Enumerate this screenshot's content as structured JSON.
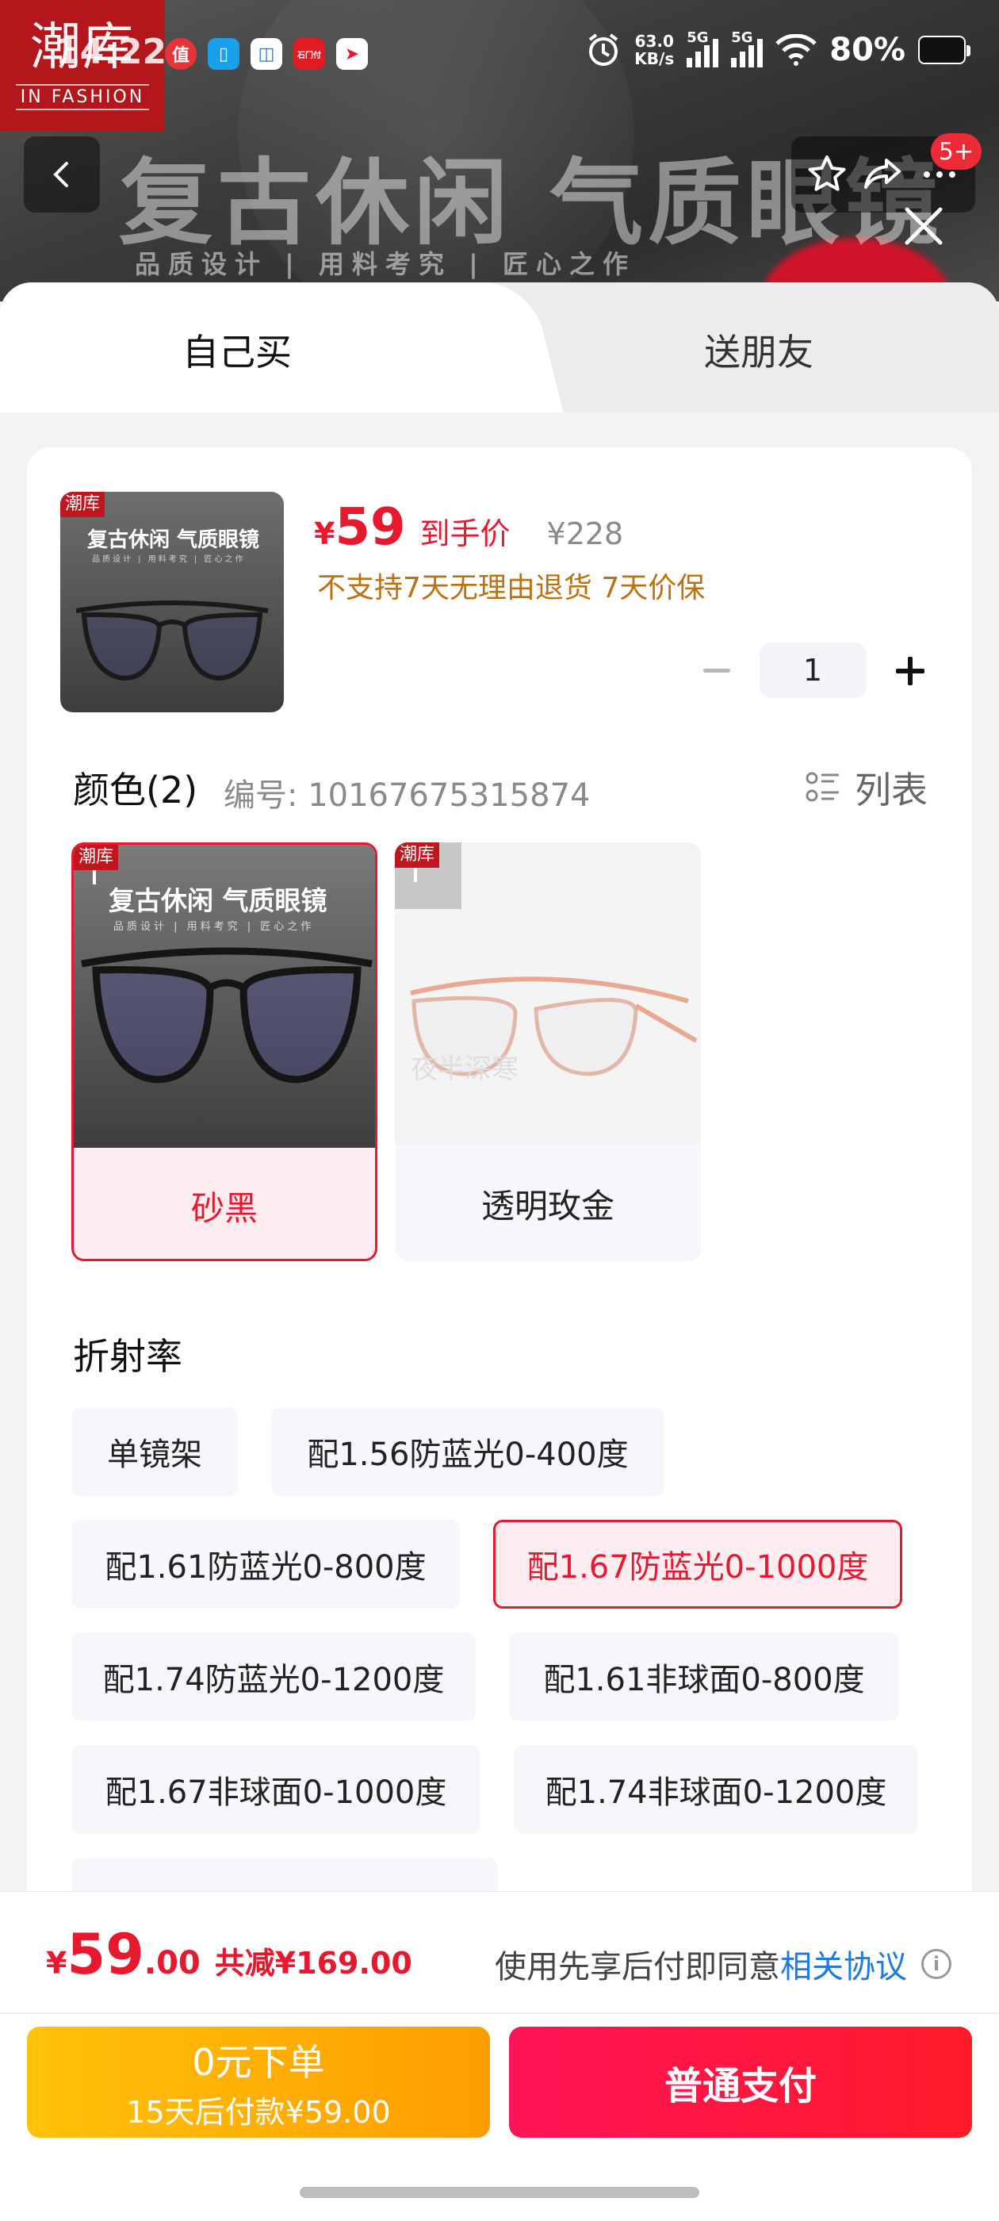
{
  "status_bar": {
    "time": "14:22",
    "net_speed_value": "63.0",
    "net_speed_unit": "KB/s",
    "signal_label_1": "5G",
    "signal_label_2": "5G",
    "battery": "80%",
    "app_badge_text": "石门付"
  },
  "banner": {
    "brand_cn": "潮库",
    "brand_en": "IN FASHION",
    "title": "复古休闲 气质眼镜",
    "subtitle": "品质设计 | 用料考究 | 匠心之作",
    "cart_badge": "5+"
  },
  "tabs": [
    {
      "label": "自己买",
      "active": true
    },
    {
      "label": "送朋友",
      "active": false
    }
  ],
  "product": {
    "thumb_tag": "潮库",
    "thumb_title": "复古休闲 气质眼镜",
    "thumb_subtitle": "品质设计 | 用料考究 | 匠心之作",
    "currency": "¥",
    "price": "59",
    "price_label": "到手价",
    "original_price": "¥228",
    "policy": "不支持7天无理由退货  7天价保",
    "quantity": "1"
  },
  "color_section": {
    "title": "颜色(2)",
    "sku_number": "编号: 10167675315874",
    "list_toggle_label": "列表",
    "options": [
      {
        "label": "砂黑",
        "selected": true,
        "tag": "潮库",
        "img_title": "复古休闲 气质眼镜",
        "img_subtitle": "品质设计 | 用料考究 | 匠心之作"
      },
      {
        "label": "透明玫金",
        "selected": false,
        "tag": "潮库",
        "watermark": "夜半深寒"
      }
    ]
  },
  "refraction_section": {
    "title": "折射率",
    "options": [
      {
        "label": "单镜架",
        "selected": false
      },
      {
        "label": "配1.56防蓝光0-400度",
        "selected": false
      },
      {
        "label": "配1.61防蓝光0-800度",
        "selected": false
      },
      {
        "label": "配1.67防蓝光0-1000度",
        "selected": true
      },
      {
        "label": "配1.74防蓝光0-1200度",
        "selected": false
      },
      {
        "label": "配1.61非球面0-800度",
        "selected": false
      },
      {
        "label": "配1.67非球面0-1000度",
        "selected": false
      },
      {
        "label": "配1.74非球面0-1200度",
        "selected": false
      }
    ]
  },
  "bottom_bar": {
    "currency": "¥",
    "price_int": "59",
    "price_dec": ".00",
    "reduction": "共减¥169.00",
    "agreement_text": "使用先享后付即同意",
    "agreement_link": "相关协议",
    "zero_order_line1": "0元下单",
    "zero_order_line2": "15天后付款¥59.00",
    "pay_button": "普通支付"
  },
  "colors": {
    "accent_red": "#e8192f",
    "policy_orange": "#c0700e",
    "link_blue": "#1e7be6",
    "zero_btn_start": "#ffc20a",
    "zero_btn_end": "#ff9d00",
    "pay_btn_start": "#ff1457",
    "pay_btn_end": "#ff1a2a"
  },
  "icons": [
    "back-icon",
    "star-icon",
    "share-icon",
    "more-icon",
    "close-icon",
    "list-icon",
    "info-icon",
    "alarm-icon",
    "wifi-icon",
    "battery-icon"
  ]
}
